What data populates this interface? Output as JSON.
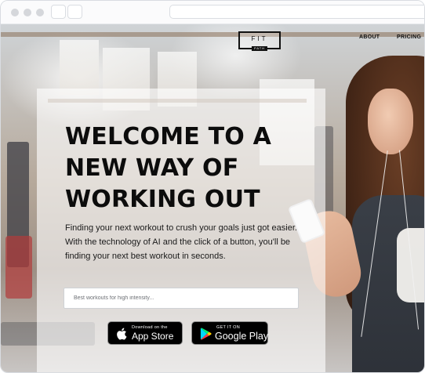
{
  "brand": {
    "logo_main": "FIT",
    "logo_sub": "PATH"
  },
  "nav": {
    "about": "ABOUT",
    "pricing": "PRICING"
  },
  "hero": {
    "headline_lines": [
      "WELCOME TO A",
      "NEW WAY OF",
      "WORKING OUT"
    ],
    "description": "Finding your next workout to crush your goals just got easier.  With the technology of AI and the click of a button, you'll be finding your next best workout in seconds."
  },
  "search": {
    "placeholder": "Best workouts for high intensity..."
  },
  "stores": {
    "apple": {
      "small": "Download on the",
      "big": "App Store"
    },
    "google": {
      "small": "GET IT ON",
      "big": "Google Play"
    }
  },
  "icons": {
    "apple": "apple-icon",
    "google_play": "google-play-icon"
  },
  "colors": {
    "text": "#0c0c0c",
    "button_bg": "#000000",
    "panel": "#ffffff"
  }
}
